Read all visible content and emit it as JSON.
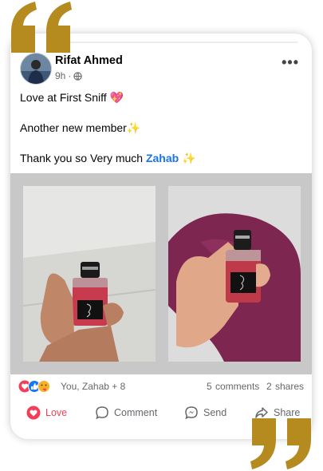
{
  "post": {
    "author": "Rifat Ahmed",
    "time": "9h",
    "line1": "Love at First Sniff",
    "line2": "Another new member",
    "line3_prefix": "Thank you so Very much ",
    "mention": "Zahab",
    "line1_emoji": "💖",
    "line2_emoji": "✨",
    "line3_emoji": "✨"
  },
  "reactions": {
    "summary": "You, Zahab + 8",
    "comments": "5 comments",
    "shares": "2 shares"
  },
  "actions": {
    "love": "Love",
    "comment": "Comment",
    "send": "Send",
    "share": "Share"
  },
  "colors": {
    "quote": "#b58a1f",
    "love": "#f33e58",
    "like": "#1877f2",
    "mention": "#1b74e4"
  }
}
